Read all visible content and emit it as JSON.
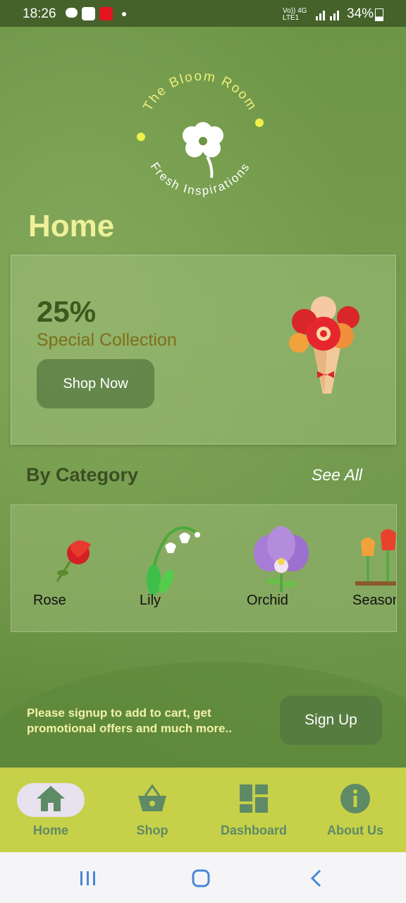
{
  "status_bar": {
    "time": "18:26",
    "network_top": "Vo)) 4G",
    "network_bottom": "LTE1",
    "battery": "34%"
  },
  "logo": {
    "top_arc": "The Bloom Room",
    "bottom_arc": "Fresh Inspirations",
    "icon": "flower-icon"
  },
  "page_title": "Home",
  "promo": {
    "percent": "25%",
    "subtitle": "Special Collection",
    "button_label": "Shop Now",
    "image": "bouquet-icon"
  },
  "category": {
    "title": "By Category",
    "see_all": "See All",
    "items": [
      {
        "label": "Rose",
        "icon": "rose-icon"
      },
      {
        "label": "Lily",
        "icon": "lily-icon"
      },
      {
        "label": "Orchid",
        "icon": "orchid-icon"
      },
      {
        "label": "Seasonal",
        "icon": "tulips-icon"
      }
    ]
  },
  "signup": {
    "text": "Please signup to add to cart, get promotional offers and much more..",
    "button_label": "Sign Up"
  },
  "bottom_nav": {
    "items": [
      {
        "label": "Home",
        "icon": "home-icon",
        "active": true
      },
      {
        "label": "Shop",
        "icon": "basket-icon",
        "active": false
      },
      {
        "label": "Dashboard",
        "icon": "dashboard-icon",
        "active": false
      },
      {
        "label": "About Us",
        "icon": "info-icon",
        "active": false
      }
    ]
  },
  "colors": {
    "title": "#eef09a",
    "nav_bg": "#c6d048",
    "nav_icon": "#5e8a66",
    "accent_text": "#7e6f1a"
  }
}
